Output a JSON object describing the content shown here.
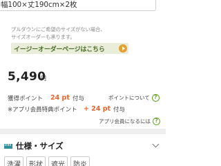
{
  "size_select": {
    "value": "幅100×丈190cm×2枚"
  },
  "note": {
    "line1": "プルダウンにご希望のサイズがない場合、",
    "line2": "サイズオーダーも承ります。"
  },
  "easy_order": {
    "label": "イージーオーダーページはこちら",
    "icon": "play-circle-icon"
  },
  "price": {
    "amount": "5,490",
    "unit": "円"
  },
  "points": {
    "label": "獲得ポイント",
    "value": "24 pt",
    "suffix": "付与",
    "help_label": "ポイントについて"
  },
  "app_points": {
    "label": "※アプリ会員特典ポイント",
    "value": "+ 24 pt",
    "suffix": "付与",
    "help_label": "アプリ会員になるには"
  },
  "specs": {
    "heading": "仕様・サイズ",
    "icon": "ruler-icon"
  },
  "spec_tags": [
    "洗濯",
    "形状",
    "遮光",
    "防炎"
  ],
  "colors": {
    "accent_green": "#69a32a",
    "points_orange": "#e8642b",
    "banner_bg": "#e9edda"
  }
}
